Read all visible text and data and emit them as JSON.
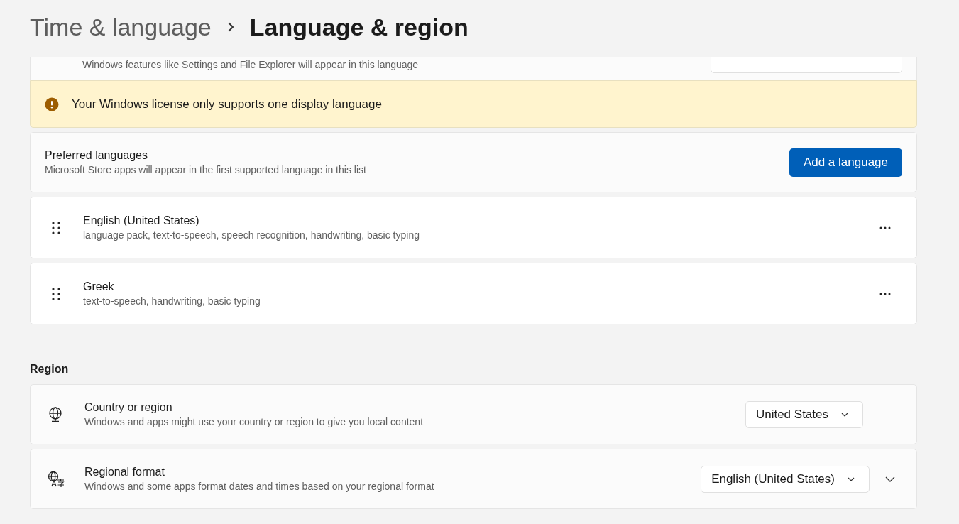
{
  "breadcrumb": {
    "parent": "Time & language",
    "current": "Language & region"
  },
  "display_language": {
    "description": "Windows features like Settings and File Explorer will appear in this language"
  },
  "warning": {
    "message": "Your Windows license only supports one display language"
  },
  "preferred_languages": {
    "title": "Preferred languages",
    "description": "Microsoft Store apps will appear in the first supported language in this list",
    "button": "Add a language"
  },
  "languages": [
    {
      "name": "English (United States)",
      "features": "language pack, text-to-speech, speech recognition, handwriting, basic typing"
    },
    {
      "name": "Greek",
      "features": "text-to-speech, handwriting, basic typing"
    }
  ],
  "region": {
    "heading": "Region",
    "settings": [
      {
        "kind": "dropdown",
        "title": "Country or region",
        "description": "Windows and apps might use your country or region to give you local content",
        "value": "United States"
      },
      {
        "kind": "expandable",
        "title": "Regional format",
        "description": "Windows and some apps format dates and times based on your regional format",
        "value": "English (United States)",
        "expanded": false
      }
    ]
  }
}
